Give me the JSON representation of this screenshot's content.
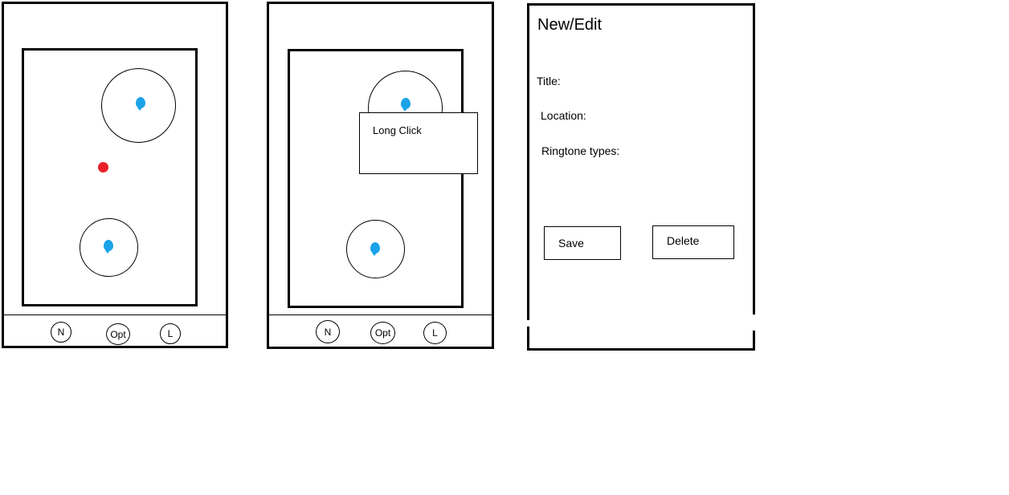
{
  "screen1": {
    "nav": {
      "new": "N",
      "options": "Opt",
      "list": "L"
    }
  },
  "screen2": {
    "popup_text": "Long Click",
    "nav": {
      "new": "N",
      "options": "Opt",
      "list": "L"
    }
  },
  "screen3": {
    "title": "New/Edit",
    "fields": {
      "title_label": "Title:",
      "location_label": "Location:",
      "ringtone_label": "Ringtone types:"
    },
    "buttons": {
      "save": "Save",
      "delete": "Delete"
    }
  },
  "colors": {
    "pin": "#1aa3e8",
    "user_location": "#e8202a"
  }
}
